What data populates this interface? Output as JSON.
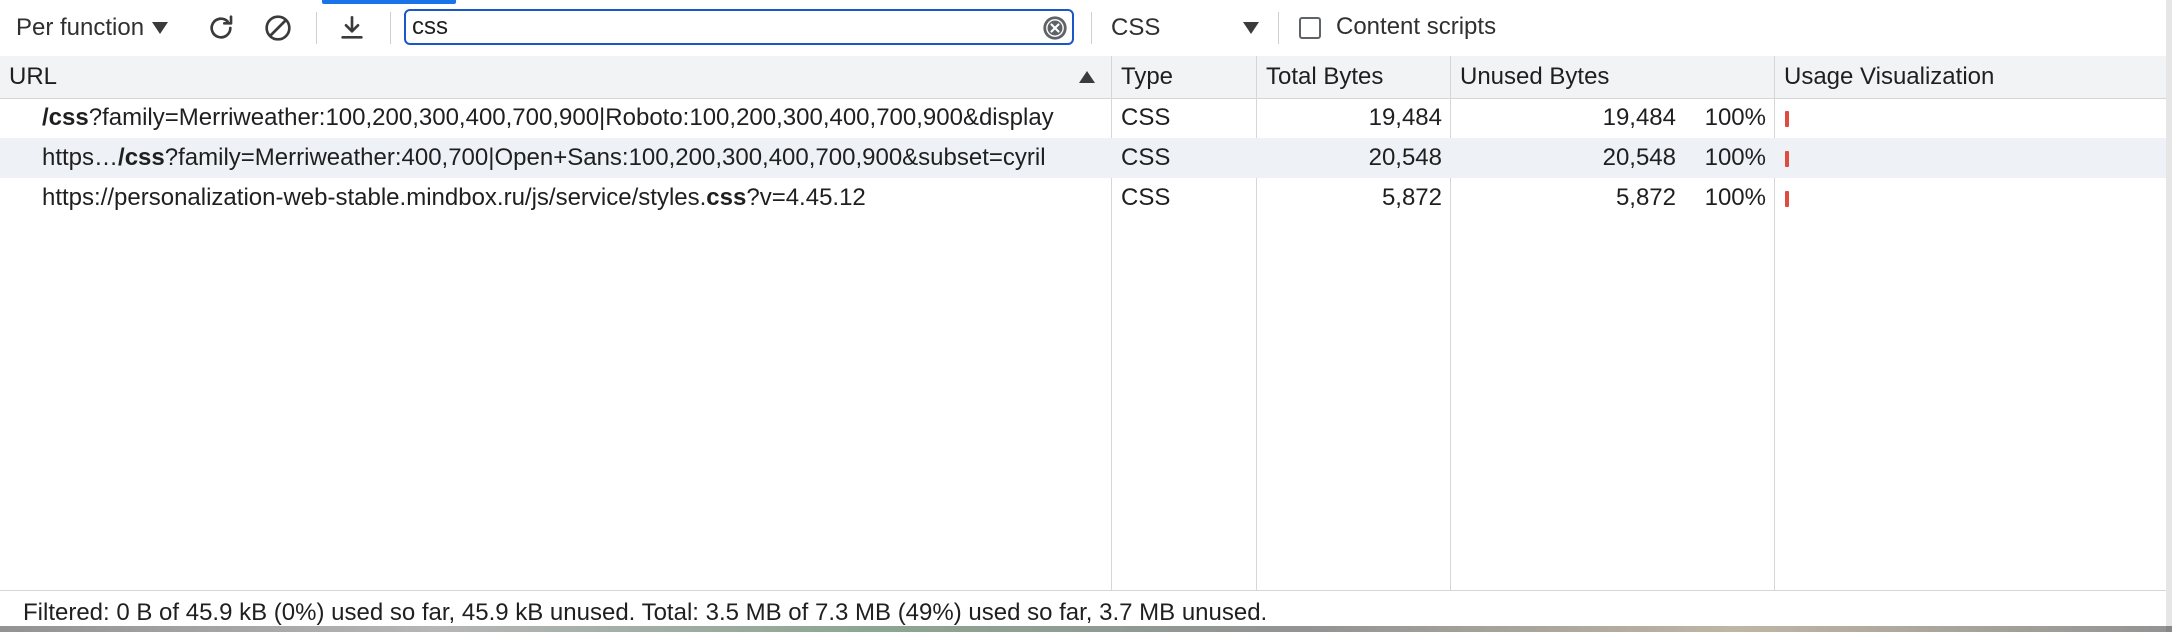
{
  "toolbar": {
    "granularity_label": "Per function",
    "search_value": "css",
    "type_filter_label": "CSS",
    "content_scripts_label": "Content scripts"
  },
  "table": {
    "columns": {
      "url": "URL",
      "type": "Type",
      "total": "Total Bytes",
      "unused": "Unused Bytes",
      "viz": "Usage Visualization"
    },
    "rows": [
      {
        "url_prefix": "",
        "url_match": "/css",
        "url_suffix": "?family=Merriweather:100,200,300,400,700,900|Roboto:100,200,300,400,700,900&display",
        "type": "CSS",
        "total": "19,484",
        "unused": "19,484",
        "pct": "100%",
        "usage_fraction": 1.0
      },
      {
        "url_prefix": "https…",
        "url_match": "/css",
        "url_suffix": "?family=Merriweather:400,700|Open+Sans:100,200,300,400,700,900&subset=cyril",
        "type": "CSS",
        "total": "20,548",
        "unused": "20,548",
        "pct": "100%",
        "usage_fraction": 1.0
      },
      {
        "url_prefix": "https://personalization-web-stable.mindbox.ru/js/service/styles.",
        "url_match": "css",
        "url_suffix": "?v=4.45.12",
        "type": "CSS",
        "total": "5,872",
        "unused": "5,872",
        "pct": "100%",
        "usage_fraction": 1.0
      }
    ]
  },
  "status": {
    "text": "Filtered: 0 B of 45.9 kB (0%) used so far, 45.9 kB unused. Total: 3.5 MB of 7.3 MB (49%) used so far, 3.7 MB unused."
  },
  "colors": {
    "accent": "#1a73e8",
    "unused_bar": "#e04a3f",
    "header_bg": "#f1f3f4",
    "selected_row_bg": "#eef1f6"
  }
}
